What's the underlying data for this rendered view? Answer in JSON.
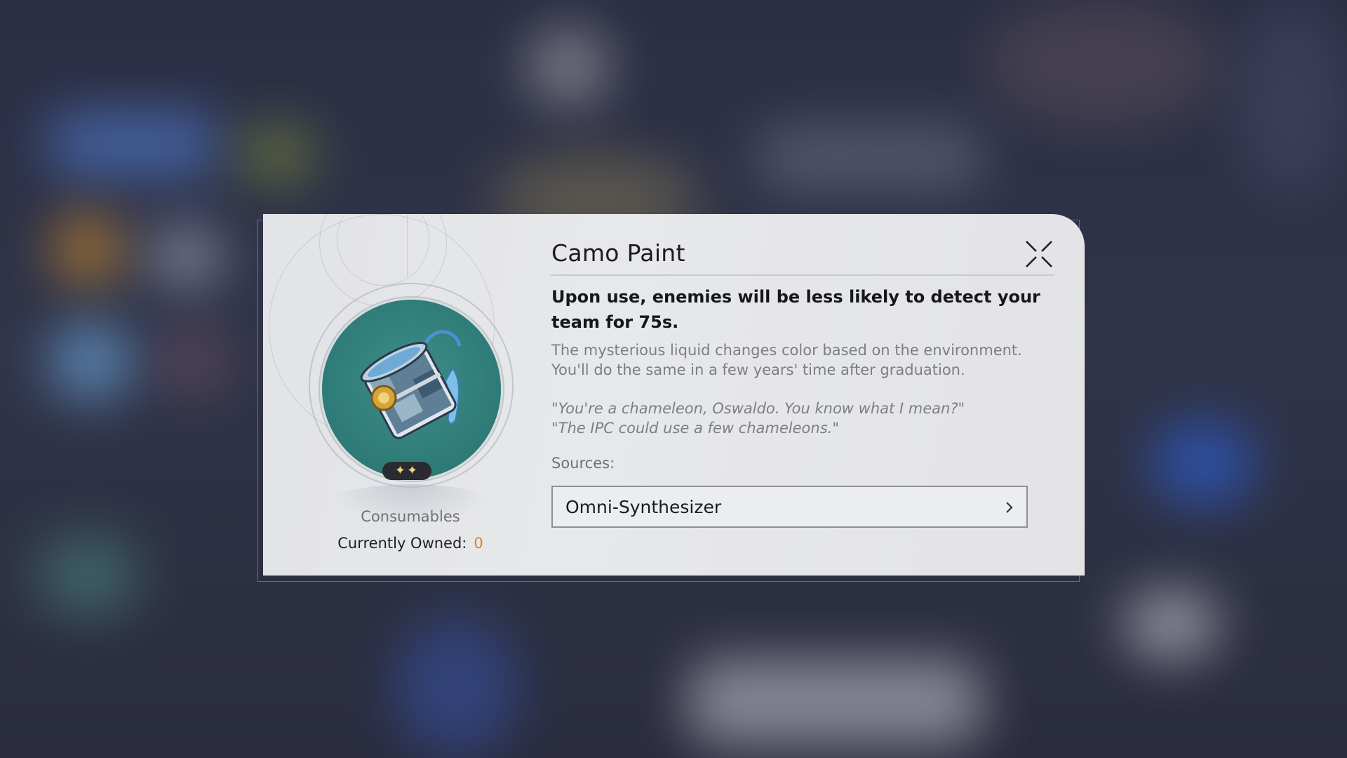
{
  "item": {
    "title": "Camo Paint",
    "effect": "Upon use, enemies will be less likely to detect your team for 75s.",
    "description_lines": [
      "The mysterious liquid changes color based on the environment.",
      "You'll do the same in a few years' time after graduation."
    ],
    "quote_lines": [
      "\"You're a chameleon, Oswaldo. You know what I mean?\"",
      "\"The IPC could use a few chameleons.\""
    ],
    "rarity": "✦✦",
    "category": "Consumables",
    "owned_label": "Currently Owned:",
    "owned_count": "0",
    "icon": "paint-bucket-icon"
  },
  "sources": {
    "label": "Sources:",
    "items": [
      {
        "name": "Omni-Synthesizer",
        "icon": "chevron-right-icon"
      }
    ]
  },
  "controls": {
    "close_icon": "close-icon"
  },
  "colors": {
    "panel": "#e4e5e8",
    "item_background": "#2d7a77",
    "owned_count": "#d08a1c",
    "rarity_stars": "#f3d27a"
  }
}
